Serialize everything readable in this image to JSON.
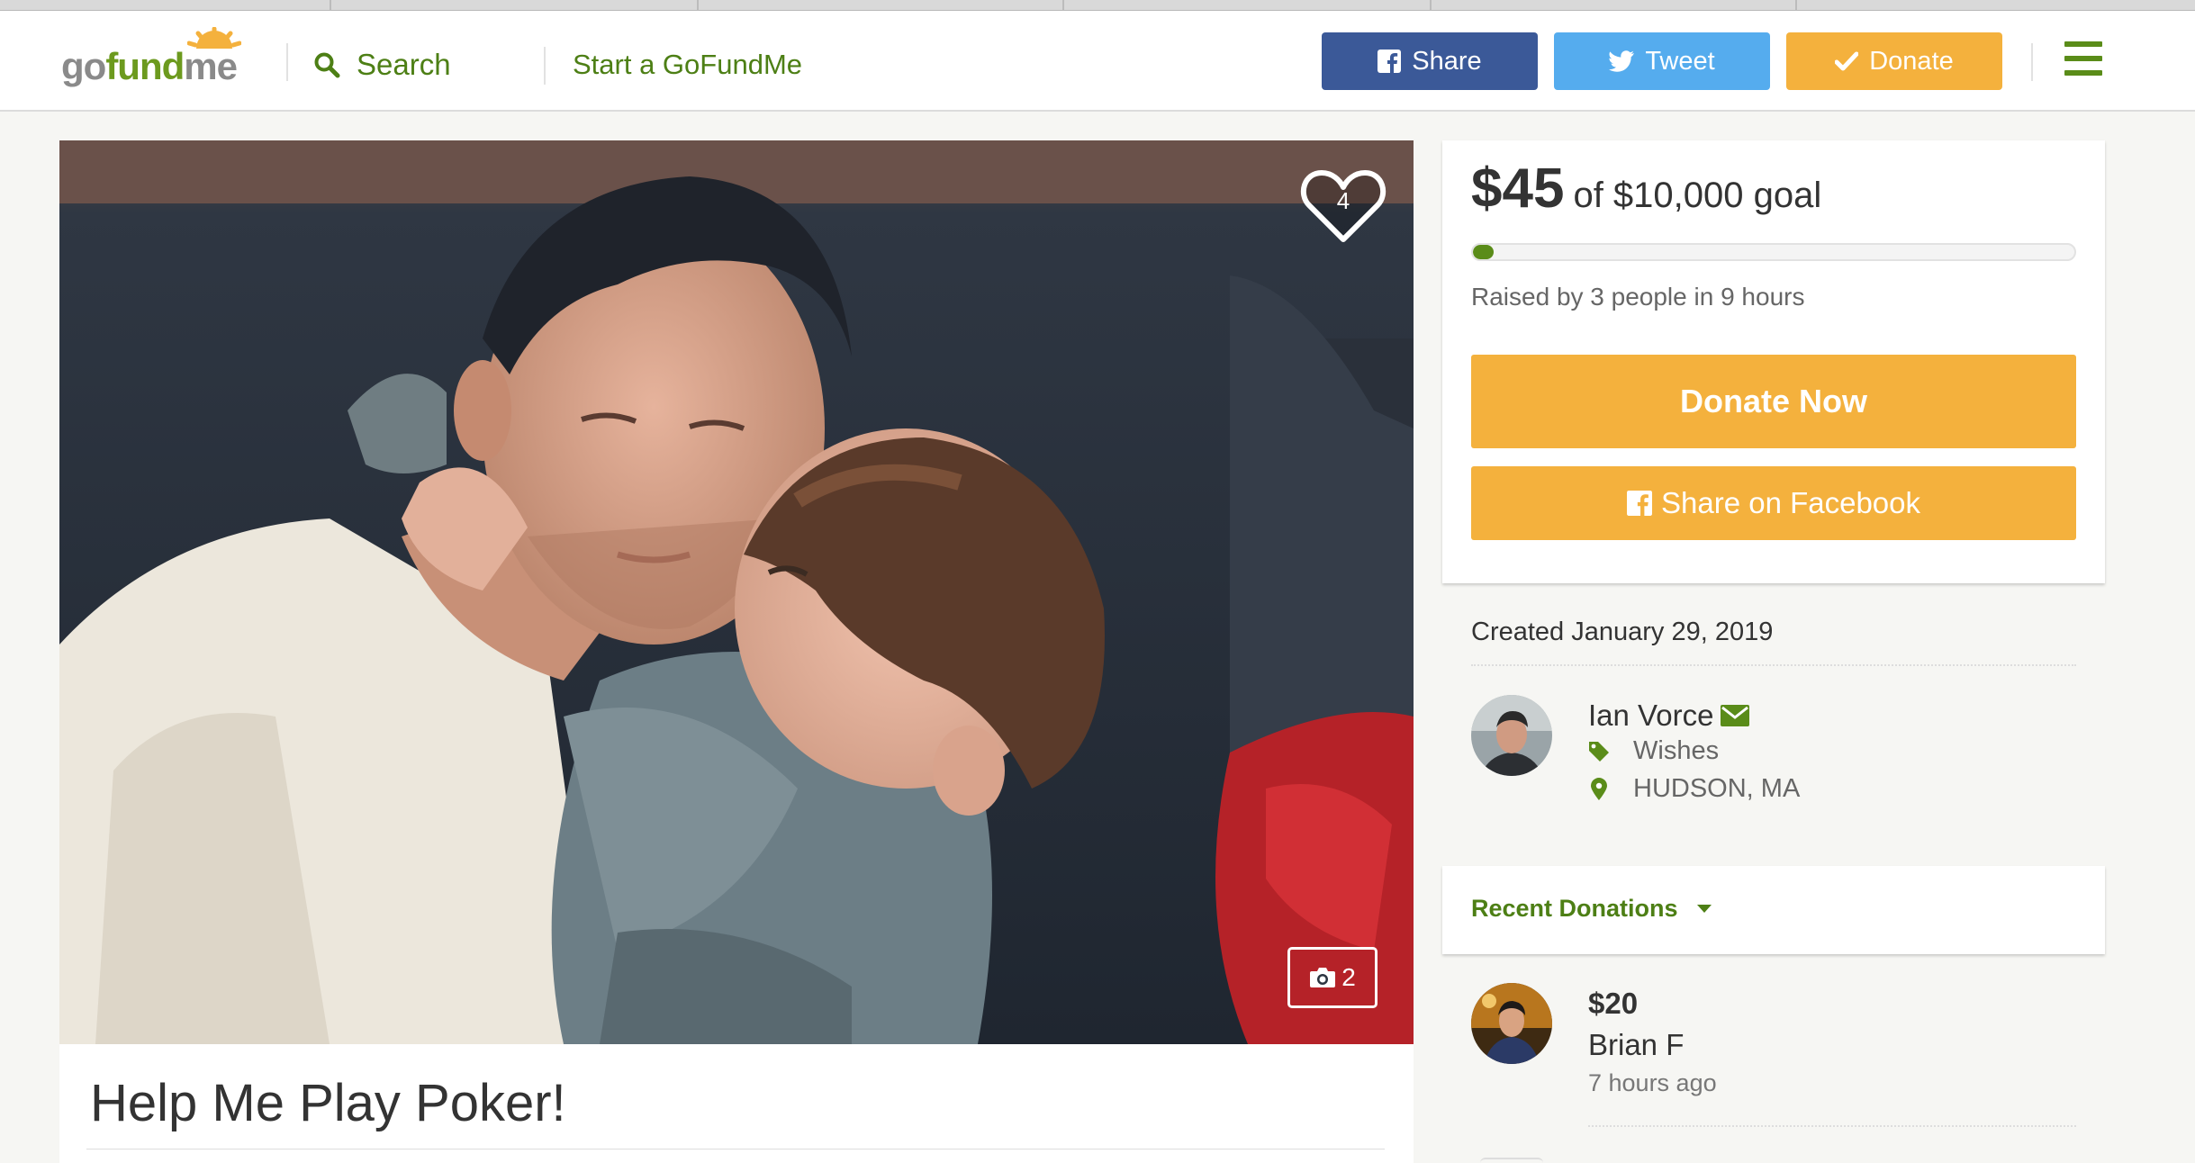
{
  "header": {
    "logo": {
      "go": "go",
      "fund": "fund",
      "me": "me"
    },
    "search_label": "Search",
    "start_label": "Start a GoFundMe",
    "share_label": "Share",
    "tweet_label": "Tweet",
    "donate_label": "Donate",
    "colors": {
      "facebook": "#3b5998",
      "twitter": "#55acee",
      "donate": "#f4b13d",
      "brand_green": "#5a8c19"
    }
  },
  "campaign": {
    "title": "Help Me Play Poker!",
    "heart_count": "4",
    "photo_count": "2"
  },
  "progress": {
    "amount": "$45",
    "goal_text": "of $10,000 goal",
    "raised_fraction": 0.0045,
    "raised_by": "Raised by 3 people in 9 hours",
    "donate_now_label": "Donate Now",
    "share_facebook_label": "Share on Facebook"
  },
  "organizer": {
    "created": "Created January 29, 2019",
    "name": "Ian Vorce",
    "category": "Wishes",
    "location": "HUDSON, MA"
  },
  "donations": {
    "heading": "Recent Donations",
    "items": [
      {
        "amount": "$20",
        "name": "Brian F",
        "time": "7 hours ago"
      }
    ]
  }
}
